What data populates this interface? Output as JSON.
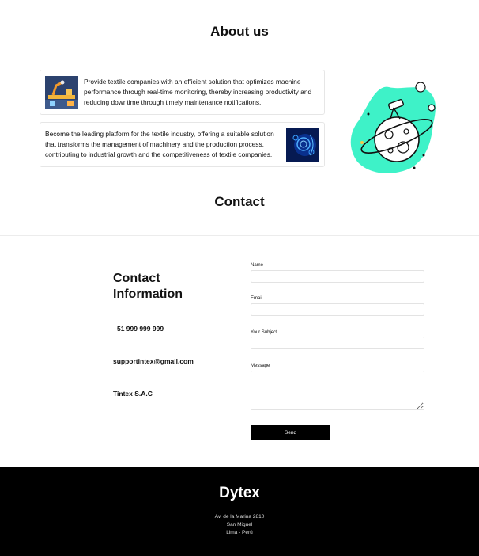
{
  "about": {
    "title": "About us",
    "card1_text": "Provide textile companies with an efficient solution that optimizes machine performance through real-time monitoring, thereby increasing productivity and reducing downtime through timely maintenance notifications.",
    "card2_text": "Become the leading platform for the textile industry, offering a suitable solution that transforms the management of machinery and the production process, contributing to industrial growth and the competitiveness of textile companies."
  },
  "contact": {
    "title": "Contact",
    "info_heading": "Contact Information",
    "phone": "+51 999 999 999",
    "email": "supportintex@gmail.com",
    "company": "Tintex S.A.C"
  },
  "form": {
    "name_label": "Name",
    "email_label": "Email",
    "subject_label": "Your Subject",
    "message_label": "Message",
    "send_label": "Send"
  },
  "footer": {
    "brand": "Dytex",
    "address_line1": "Av. de la Marina 2810",
    "address_line2": "San Miguel",
    "address_line3": "Lima - Perú"
  },
  "colors": {
    "accent": "#3ef2c8",
    "footer_bg": "#000000"
  }
}
